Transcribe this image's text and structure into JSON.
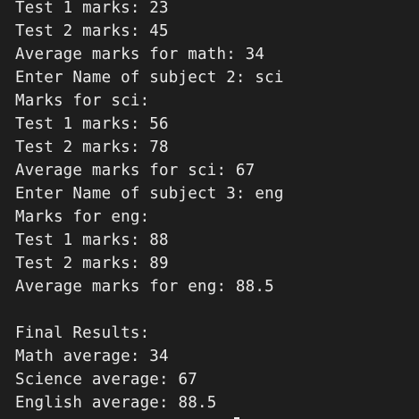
{
  "terminal": {
    "lines": [
      "Test 1 marks: 23",
      "Test 2 marks: 45",
      "Average marks for math: 34",
      "Enter Name of subject 2: sci",
      "Marks for sci:",
      "Test 1 marks: 56",
      "Test 2 marks: 78",
      "Average marks for sci: 67",
      "Enter Name of subject 3: eng",
      "Marks for eng:",
      "Test 1 marks: 88",
      "Test 2 marks: 89",
      "Average marks for eng: 88.5",
      "",
      "Final Results:",
      "Math average: 34",
      "Science average: 67",
      "English average: 88.5"
    ]
  }
}
